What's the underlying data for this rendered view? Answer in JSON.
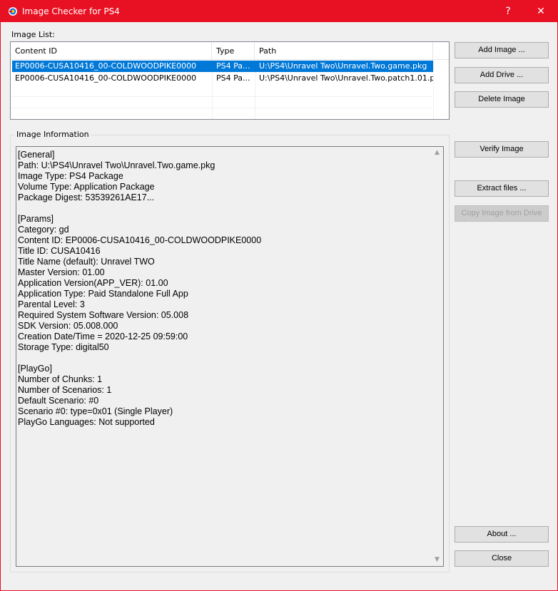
{
  "window": {
    "title": "Image Checker for PS4",
    "help_glyph": "?",
    "close_glyph": "✕"
  },
  "image_list": {
    "label": "Image List:",
    "columns": [
      "Content ID",
      "Type",
      "Path"
    ],
    "rows": [
      {
        "content_id": "EP0006-CUSA10416_00-COLDWOODPIKE0000",
        "type": "PS4 Pa...",
        "path": "U:\\PS4\\Unravel Two\\Unravel.Two.game.pkg",
        "selected": true
      },
      {
        "content_id": "EP0006-CUSA10416_00-COLDWOODPIKE0000",
        "type": "PS4 Pa...",
        "path": "U:\\PS4\\Unravel Two\\Unravel.Two.patch1.01.p...",
        "selected": false
      }
    ]
  },
  "image_information": {
    "label": "Image Information",
    "lines": [
      "[General]",
      "Path: U:\\PS4\\Unravel Two\\Unravel.Two.game.pkg",
      "Image Type: PS4 Package",
      "Volume Type: Application Package",
      "Package Digest: 53539261AE17...",
      "",
      "[Params]",
      "Category: gd",
      "Content ID: EP0006-CUSA10416_00-COLDWOODPIKE0000",
      "Title ID: CUSA10416",
      "Title Name (default): Unravel TWO",
      "Master Version: 01.00",
      "Application Version(APP_VER): 01.00",
      "Application Type: Paid Standalone Full App",
      "Parental Level: 3",
      "Required System Software Version: 05.008",
      "SDK Version: 05.008.000",
      "Creation Date/Time = 2020-12-25 09:59:00",
      "Storage Type: digital50",
      "",
      "[PlayGo]",
      "Number of Chunks: 1",
      "Number of Scenarios: 1",
      "Default Scenario: #0",
      "Scenario #0: type=0x01 (Single Player)",
      "PlayGo Languages: Not supported"
    ]
  },
  "buttons": {
    "add_image": "Add Image ...",
    "add_drive": "Add Drive ...",
    "delete_image": "Delete Image",
    "verify_image": "Verify Image",
    "extract_files": "Extract files ...",
    "copy_image_from_drive": "Copy Image from Drive",
    "about": "About ...",
    "close": "Close"
  },
  "colors": {
    "titlebar": "#e81123",
    "selection": "#0078d7"
  }
}
